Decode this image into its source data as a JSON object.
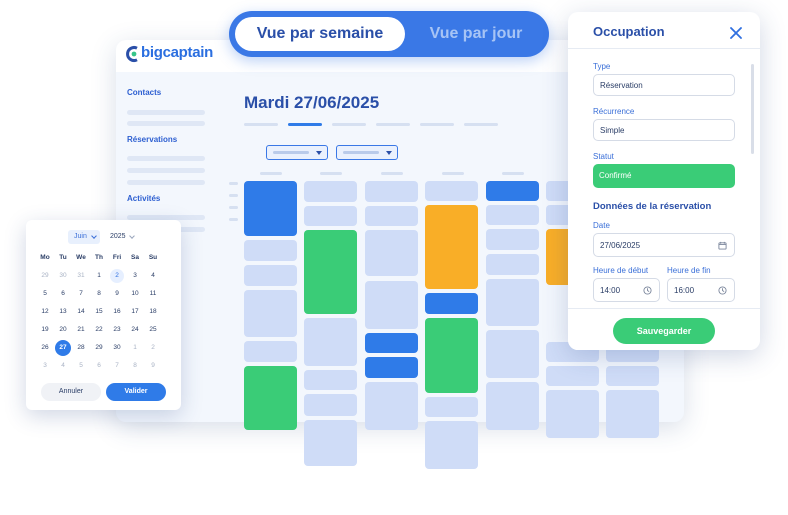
{
  "view_toggle": {
    "active": "Vue par semaine",
    "inactive": "Vue par jour"
  },
  "app": {
    "brand": "bigcaptain",
    "sidebar_sections": [
      "Contacts",
      "Réservations",
      "Activités"
    ],
    "date_title": "Mardi 27/06/2025"
  },
  "datepicker": {
    "month": "Juin",
    "year": "2025",
    "weekdays": [
      "Mo",
      "Tu",
      "We",
      "Th",
      "Fri",
      "Sa",
      "Su"
    ],
    "weeks": [
      [
        "29",
        "30",
        "31",
        "1",
        "2",
        "3",
        "4"
      ],
      [
        "5",
        "6",
        "7",
        "8",
        "9",
        "10",
        "11"
      ],
      [
        "12",
        "13",
        "14",
        "15",
        "16",
        "17",
        "18"
      ],
      [
        "19",
        "20",
        "21",
        "22",
        "23",
        "24",
        "25"
      ],
      [
        "26",
        "27",
        "28",
        "29",
        "30",
        "1",
        "2"
      ],
      [
        "3",
        "4",
        "5",
        "6",
        "7",
        "8",
        "9"
      ]
    ],
    "selected": "27",
    "today": "2",
    "cancel_label": "Annuler",
    "ok_label": "Valider"
  },
  "panel": {
    "title": "Occupation",
    "type_label": "Type",
    "type_value": "Réservation",
    "recurrence_label": "Récurrence",
    "recurrence_value": "Simple",
    "status_label": "Statut",
    "status_value": "Confirmé",
    "section_title": "Données de la réservation",
    "date_label": "Date",
    "date_value": "27/06/2025",
    "start_label": "Heure de début",
    "start_value": "14:00",
    "end_label": "Heure de fin",
    "end_value": "16:00",
    "save_label": "Sauvegarder"
  },
  "colors": {
    "accent": "#3a78e6",
    "confirmed": "#3acc77",
    "highlight": "#f9ae27",
    "title": "#2a4fa8"
  }
}
